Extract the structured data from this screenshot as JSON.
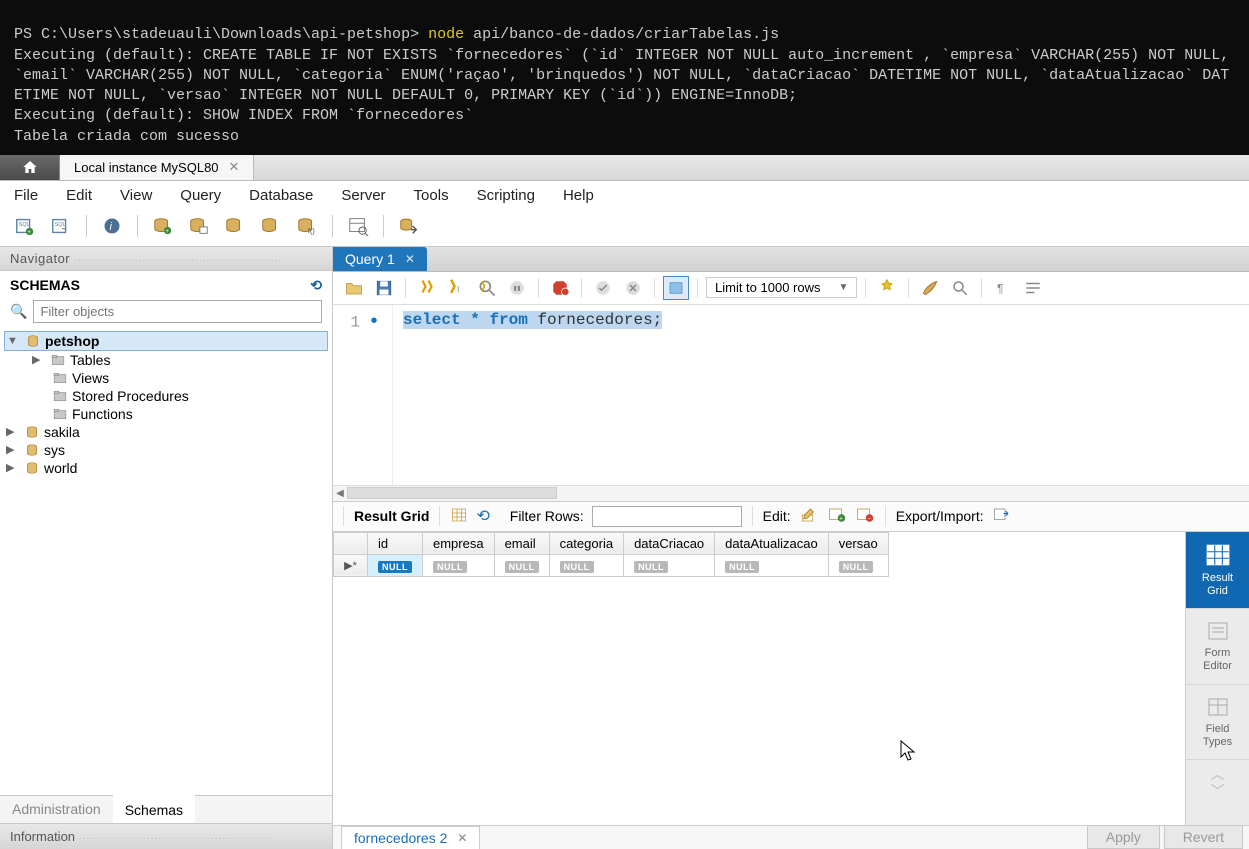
{
  "terminal": {
    "prompt": "PS C:\\Users\\stadeuauli\\Downloads\\api-petshop>",
    "cmd_node": "node",
    "cmd_arg": "api/banco-de-dados/criarTabelas.js",
    "line2": "Executing (default): CREATE TABLE IF NOT EXISTS `fornecedores` (`id` INTEGER NOT NULL auto_increment , `empresa` VARCHAR(255) NOT NULL, `email` VARCHAR(255) NOT NULL, `categoria` ENUM('raçao', 'brinquedos') NOT NULL, `dataCriacao` DATETIME NOT NULL, `dataAtualizacao` DATETIME NOT NULL, `versao` INTEGER NOT NULL DEFAULT 0, PRIMARY KEY (`id`)) ENGINE=InnoDB;",
    "line3": "Executing (default): SHOW INDEX FROM `fornecedores`",
    "line4": "Tabela criada com sucesso"
  },
  "tabbar": {
    "conn_label": "Local instance MySQL80"
  },
  "menu": [
    "File",
    "Edit",
    "View",
    "Query",
    "Database",
    "Server",
    "Tools",
    "Scripting",
    "Help"
  ],
  "navigator": {
    "title": "Navigator",
    "schemas_label": "SCHEMAS",
    "filter_placeholder": "Filter objects",
    "tree": {
      "db_open": "petshop",
      "db_open_children": [
        "Tables",
        "Views",
        "Stored Procedures",
        "Functions"
      ],
      "other_dbs": [
        "sakila",
        "sys",
        "world"
      ]
    },
    "bottom_tabs": {
      "admin": "Administration",
      "schemas": "Schemas"
    },
    "info_label": "Information"
  },
  "query_tab": {
    "label": "Query 1"
  },
  "limit": "Limit to 1000 rows",
  "sql": {
    "line_num": "1",
    "kw1": "select",
    "star": "*",
    "kw2": "from",
    "ident": "fornecedores;"
  },
  "result_toolbar": {
    "result_grid": "Result Grid",
    "filter_rows": "Filter Rows:",
    "edit": "Edit:",
    "export": "Export/Import:"
  },
  "grid": {
    "columns": [
      "id",
      "empresa",
      "email",
      "categoria",
      "dataCriacao",
      "dataAtualizacao",
      "versao"
    ],
    "null": "NULL"
  },
  "side_tabs": {
    "result": "Result\nGrid",
    "form": "Form\nEditor",
    "field": "Field\nTypes"
  },
  "bottom": {
    "tab": "fornecedores 2",
    "apply": "Apply",
    "revert": "Revert"
  }
}
